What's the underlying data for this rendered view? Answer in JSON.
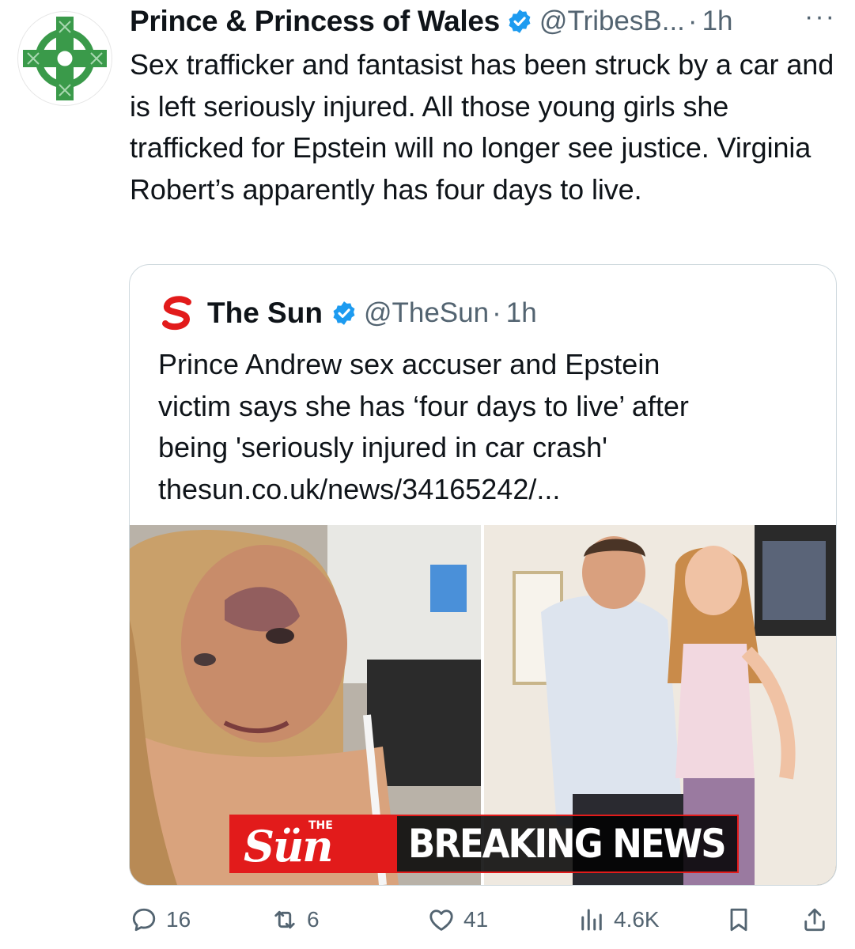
{
  "tweet": {
    "author_name": "Prince & Princess of Wales",
    "handle": "@TribesB...",
    "separator": "·",
    "time": "1h",
    "more_label": "···",
    "text": "Sex trafficker and fantasist has been struck by a car and is left seriously injured. All those young girls she trafficked for Epstein will no longer see justice. Virginia Robert’s apparently has four days to live."
  },
  "quote": {
    "author_name": "The Sun",
    "handle": "@TheSun",
    "separator": "·",
    "time": "1h",
    "text_lines": [
      "Prince Andrew sex accuser and Epstein",
      "victim says she has ‘four days to live’ after",
      "being 'seriously injured in car crash'",
      "thesun.co.uk/news/34165242/..."
    ],
    "banner": {
      "logo_small": "THE",
      "logo_big": "Sün",
      "text": "BREAKING NEWS"
    }
  },
  "actions": {
    "replies": "16",
    "reposts": "6",
    "likes": "41",
    "views": "4.6K"
  },
  "icons": {
    "avatar": "celtic-cross-icon",
    "verified": "verified-badge-icon",
    "reply": "reply-icon",
    "repost": "repost-icon",
    "like": "heart-icon",
    "views": "views-icon",
    "bookmark": "bookmark-icon",
    "share": "share-icon"
  },
  "colors": {
    "text": "#0f1419",
    "secondary": "#536471",
    "verified": "#1d9bf0",
    "avatar_green": "#3a9a4a",
    "sun_red": "#e21b1b"
  }
}
